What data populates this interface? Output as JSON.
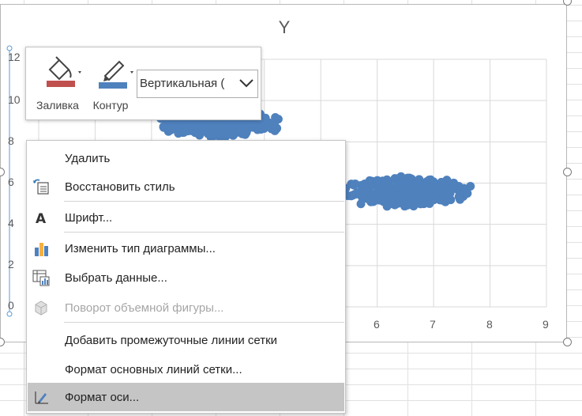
{
  "chart": {
    "title": "Y",
    "y_ticks": [
      "0",
      "2",
      "4",
      "6",
      "8",
      "10",
      "12"
    ],
    "x_ticks_visible": [
      "6",
      "7",
      "8",
      "9"
    ]
  },
  "chart_data": {
    "type": "scatter",
    "title": "Y",
    "xlabel": "",
    "ylabel": "",
    "xlim": [
      0,
      9
    ],
    "ylim": [
      0,
      12
    ],
    "grid": true,
    "series": [
      {
        "color": "#4f81bd",
        "clusters": [
          {
            "x_range": [
              2.3,
              4.4
            ],
            "y_range": [
              8.2,
              9.8
            ],
            "description_x_center": 3.2,
            "description_y_center": 8.9
          },
          {
            "x_range": [
              5.4,
              7.8
            ],
            "y_range": [
              4.7,
              6.4
            ],
            "description_x_center": 6.5,
            "description_y_center": 5.6
          }
        ]
      }
    ],
    "x_ticks": [
      6,
      7,
      8,
      9
    ],
    "y_ticks": [
      0,
      2,
      4,
      6,
      8,
      10,
      12
    ]
  },
  "toolbar": {
    "fill_label": "Заливка",
    "outline_label": "Контур",
    "element_selector_value": "Вертикальная (",
    "fill_color": "#c0504d",
    "outline_color": "#4f81bd"
  },
  "context_menu": {
    "items": [
      {
        "label": "Удалить",
        "icon": "none",
        "enabled": true
      },
      {
        "label": "Восстановить стиль",
        "icon": "reset-style-icon",
        "enabled": true
      },
      {
        "label": "Шрифт...",
        "icon": "font-icon",
        "enabled": true
      },
      {
        "label": "Изменить тип диаграммы...",
        "icon": "chart-type-icon",
        "enabled": true
      },
      {
        "label": "Выбрать данные...",
        "icon": "select-data-icon",
        "enabled": true
      },
      {
        "label": "Поворот объемной фигуры...",
        "icon": "3d-rotation-icon",
        "enabled": false
      },
      {
        "label": "Добавить промежуточные линии сетки",
        "icon": "none",
        "enabled": true
      },
      {
        "label": "Формат основных линий сетки...",
        "icon": "none",
        "enabled": true
      },
      {
        "label": "Формат оси...",
        "icon": "format-axis-icon",
        "enabled": true,
        "highlighted": true
      }
    ]
  }
}
